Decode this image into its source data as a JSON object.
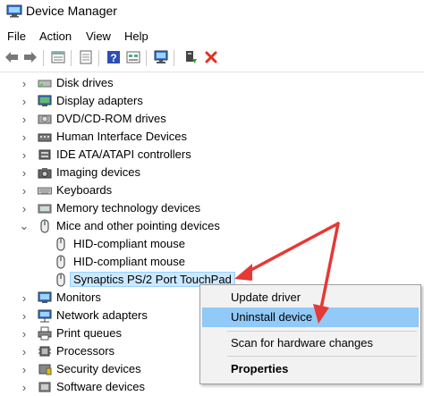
{
  "window": {
    "title": "Device Manager"
  },
  "menubar": {
    "items": [
      "File",
      "Action",
      "View",
      "Help"
    ]
  },
  "toolbar": {
    "buttons": [
      "back-icon",
      "forward-icon",
      "properties-icon",
      "update-icon",
      "help-icon",
      "view-icon",
      "scan-icon",
      "enable-icon",
      "uninstall-icon"
    ]
  },
  "tree": {
    "items": [
      {
        "label": "Disk drives"
      },
      {
        "label": "Display adapters"
      },
      {
        "label": "DVD/CD-ROM drives"
      },
      {
        "label": "Human Interface Devices"
      },
      {
        "label": "IDE ATA/ATAPI controllers"
      },
      {
        "label": "Imaging devices"
      },
      {
        "label": "Keyboards"
      },
      {
        "label": "Memory technology devices"
      },
      {
        "label": "Mice and other pointing devices"
      },
      {
        "label": "HID-compliant mouse"
      },
      {
        "label": "HID-compliant mouse"
      },
      {
        "label": "Synaptics PS/2 Port TouchPad"
      },
      {
        "label": "Monitors"
      },
      {
        "label": "Network adapters"
      },
      {
        "label": "Print queues"
      },
      {
        "label": "Processors"
      },
      {
        "label": "Security devices"
      },
      {
        "label": "Software devices"
      }
    ]
  },
  "context_menu": {
    "update_driver": "Update driver",
    "uninstall_device": "Uninstall device",
    "scan_changes": "Scan for hardware changes",
    "properties": "Properties"
  },
  "colors": {
    "highlight": "#91c9f7",
    "selection": "#cce8ff",
    "arrow": "#e53935"
  }
}
